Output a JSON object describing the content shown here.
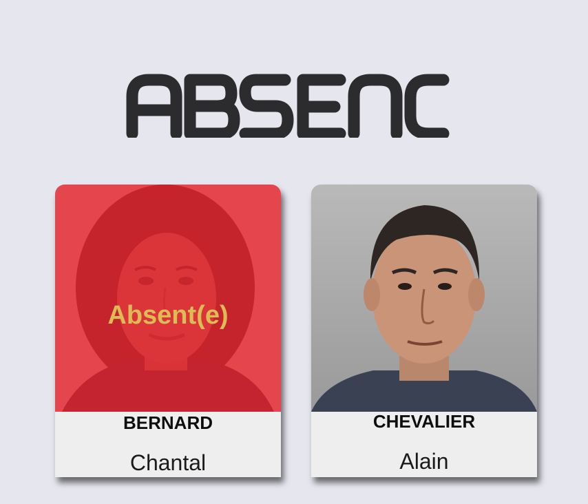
{
  "header": {
    "title": "ABSENCE"
  },
  "people": [
    {
      "last_name": "BERNARD",
      "first_name": "Chantal",
      "status": "Absent(e)",
      "overlay_color": "#e82732",
      "status_color": "#dcbc55"
    },
    {
      "last_name": "CHEVALIER",
      "first_name": "Alain",
      "status": null
    }
  ],
  "colors": {
    "background": "#e5e6ee",
    "title": "#2c2c2e",
    "card": "#eeeeef"
  }
}
